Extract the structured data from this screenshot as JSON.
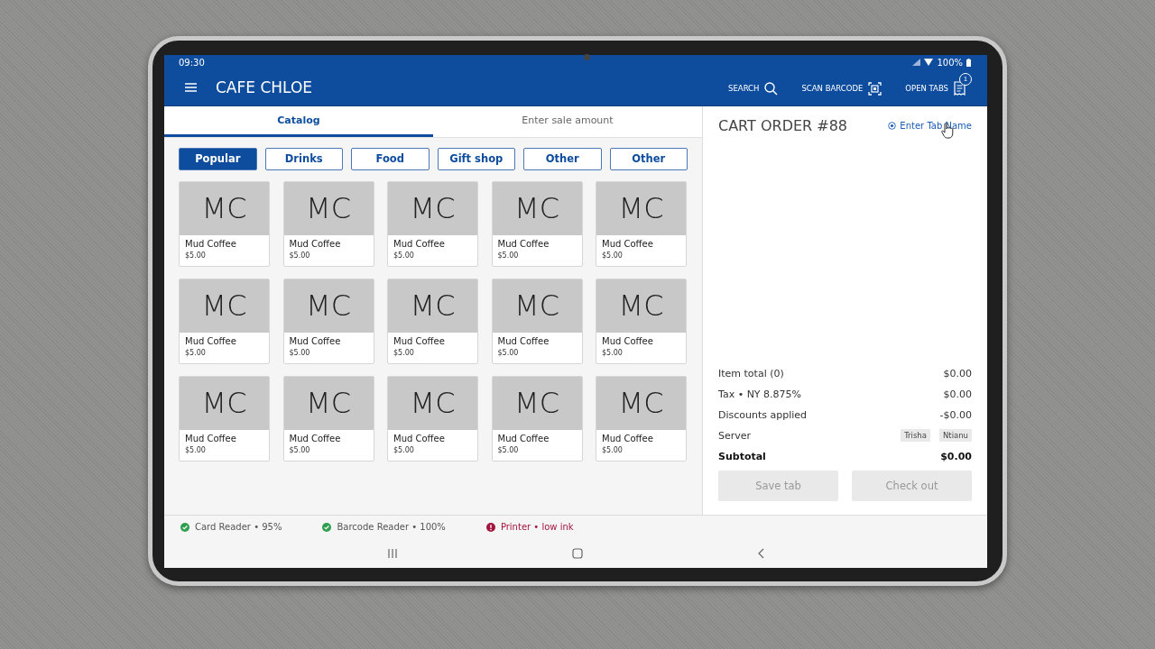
{
  "status_bar": {
    "time": "09:30",
    "battery": "100%"
  },
  "app_bar": {
    "title": "CAFE CHLOE",
    "actions": [
      {
        "label": "SEARCH",
        "kind": "search"
      },
      {
        "label": "SCAN BARCODE",
        "kind": "scan"
      },
      {
        "label": "OPEN TABS",
        "kind": "tabs",
        "badge": "1"
      }
    ]
  },
  "tabs": [
    {
      "label": "Catalog",
      "selected": true
    },
    {
      "label": "Enter sale amount",
      "selected": false
    }
  ],
  "categories": [
    {
      "label": "Popular",
      "selected": true
    },
    {
      "label": "Drinks",
      "selected": false
    },
    {
      "label": "Food",
      "selected": false
    },
    {
      "label": "Gift shop",
      "selected": false
    },
    {
      "label": "Other",
      "selected": false
    },
    {
      "label": "Other",
      "selected": false
    }
  ],
  "products": [
    {
      "initials": "MC",
      "name": "Mud Coffee",
      "price": "$5.00"
    },
    {
      "initials": "MC",
      "name": "Mud Coffee",
      "price": "$5.00"
    },
    {
      "initials": "MC",
      "name": "Mud Coffee",
      "price": "$5.00"
    },
    {
      "initials": "MC",
      "name": "Mud Coffee",
      "price": "$5.00"
    },
    {
      "initials": "MC",
      "name": "Mud Coffee",
      "price": "$5.00"
    },
    {
      "initials": "MC",
      "name": "Mud Coffee",
      "price": "$5.00"
    },
    {
      "initials": "MC",
      "name": "Mud Coffee",
      "price": "$5.00"
    },
    {
      "initials": "MC",
      "name": "Mud Coffee",
      "price": "$5.00"
    },
    {
      "initials": "MC",
      "name": "Mud Coffee",
      "price": "$5.00"
    },
    {
      "initials": "MC",
      "name": "Mud Coffee",
      "price": "$5.00"
    },
    {
      "initials": "MC",
      "name": "Mud Coffee",
      "price": "$5.00"
    },
    {
      "initials": "MC",
      "name": "Mud Coffee",
      "price": "$5.00"
    },
    {
      "initials": "MC",
      "name": "Mud Coffee",
      "price": "$5.00"
    },
    {
      "initials": "MC",
      "name": "Mud Coffee",
      "price": "$5.00"
    },
    {
      "initials": "MC",
      "name": "Mud Coffee",
      "price": "$5.00"
    }
  ],
  "cart": {
    "title": "CART ORDER #88",
    "tab_name_link": "Enter Tab Name",
    "summary": [
      {
        "label": "Item total (0)",
        "value": "$0.00"
      },
      {
        "label": "Tax •  NY 8.875%",
        "value": "$0.00"
      },
      {
        "label": "Discounts applied",
        "value": "-$0.00"
      }
    ],
    "server": {
      "label": "Server",
      "tags": [
        "Trisha",
        "Ntianu"
      ]
    },
    "subtotal": {
      "label": "Subtotal",
      "value": "$0.00"
    },
    "buttons": [
      {
        "label": "Save tab",
        "disabled": true
      },
      {
        "label": "Check out",
        "disabled": true
      }
    ]
  },
  "devices": [
    {
      "label": "Card Reader • 95%",
      "kind": "ok",
      "color": "#2e9e4f"
    },
    {
      "label": "Barcode Reader • 100%",
      "kind": "ok",
      "color": "#2e9e4f"
    },
    {
      "label": "Printer • low ink",
      "kind": "error",
      "color": "#a3153f"
    }
  ]
}
